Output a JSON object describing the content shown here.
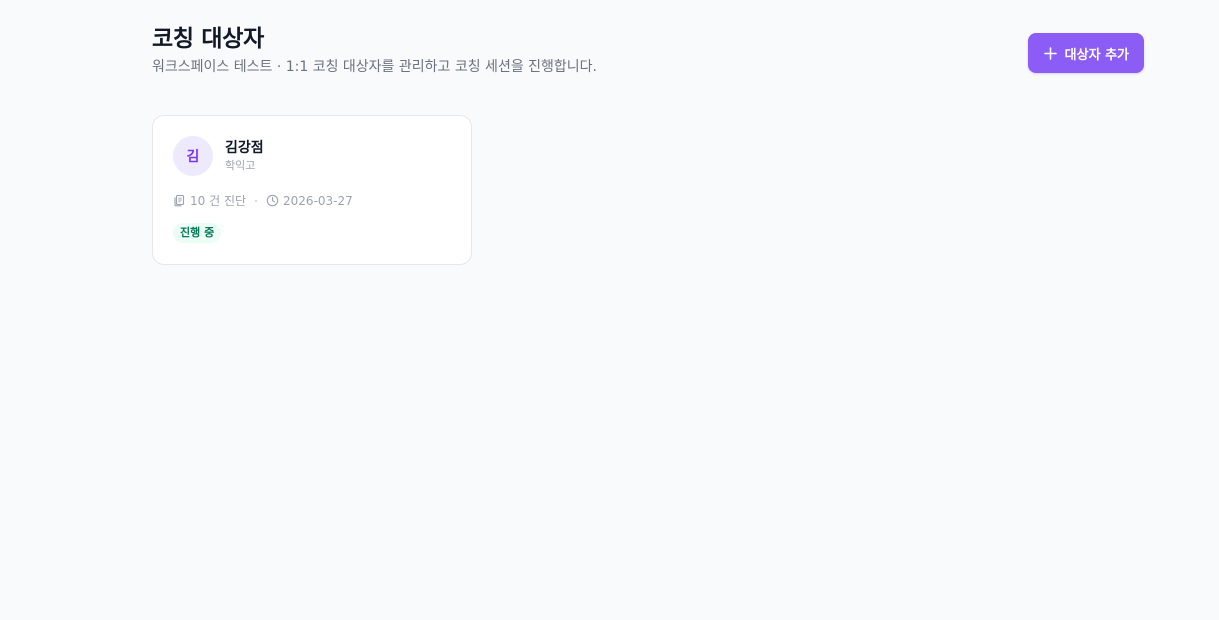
{
  "header": {
    "title": "코칭 대상자",
    "subtitle": "워크스페이스 테스트 · 1:1 코칭 대상자를 관리하고 코칭 세션을 진행합니다.",
    "add_button_label": "대상자 추가",
    "add_button_icon": "plus-icon"
  },
  "colors": {
    "accent": "#8b5cf6",
    "avatar_bg": "#ede9fe",
    "avatar_text": "#7c3aed",
    "status_bg": "#ecfdf5",
    "status_text": "#047857"
  },
  "coachees": [
    {
      "avatar_initial": "김",
      "name": "김강점",
      "organization": "학익고",
      "diagnosis_count": "10 건 진단",
      "diagnosis_icon": "documents-icon",
      "date": "2026-03-27",
      "date_icon": "clock-icon",
      "status": "진행 중"
    }
  ]
}
